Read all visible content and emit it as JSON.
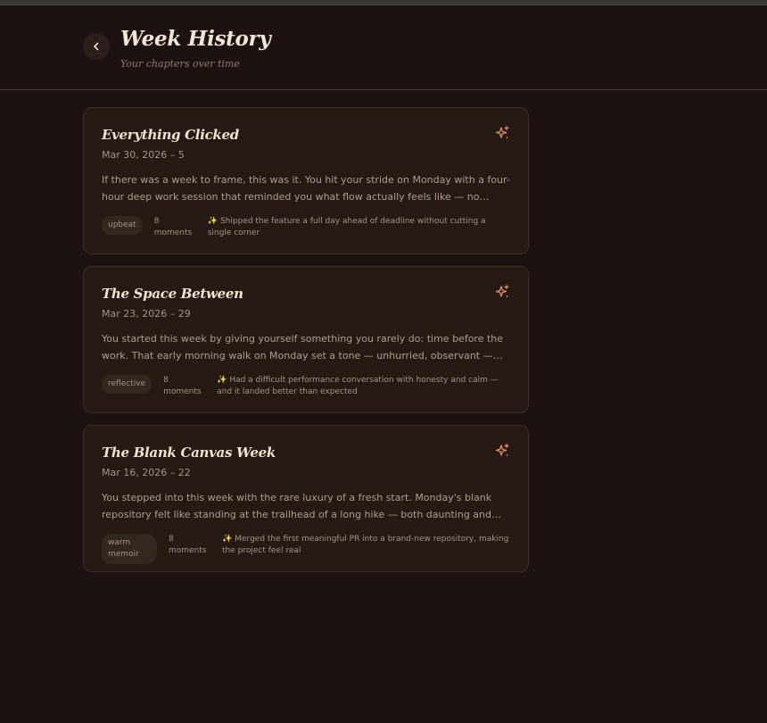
{
  "header": {
    "title": "Week History",
    "subtitle": "Your chapters over time"
  },
  "weeks": [
    {
      "title": "Everything Clicked",
      "date": "Mar 30, 2026 – 5",
      "excerpt": "If there was a week to frame, this was it. You hit your stride on Monday with a four-hour deep work session that reminded you what flow actually feels like — no pings, no…",
      "tag": "upbeat",
      "moments": "8 moments",
      "highlight_icon": "✨",
      "highlight": "Shipped the feature a full day ahead of deadline without cutting a single corner"
    },
    {
      "title": "The Space Between",
      "date": "Mar 23, 2026 – 29",
      "excerpt": "You started this week by giving yourself something you rarely do: time before the work. That early morning walk on Monday set a tone — unhurried, observant — that threaded…",
      "tag": "reflective",
      "moments": "8 moments",
      "highlight_icon": "✨",
      "highlight": "Had a difficult performance conversation with honesty and calm — and it landed better than expected"
    },
    {
      "title": "The Blank Canvas Week",
      "date": "Mar 16, 2026 – 22",
      "excerpt": "You stepped into this week with the rare luxury of a fresh start. Monday's blank repository felt like standing at the trailhead of a long hike — both daunting and…",
      "tag": "warm memoir",
      "moments": "8 moments",
      "highlight_icon": "✨",
      "highlight": "Merged the first meaningful PR into a brand-new repository, making the project feel real"
    }
  ],
  "colors": {
    "background": "#1c1311",
    "card": "#251a14",
    "accent": "#e08a5e",
    "title": "#f3e6d4"
  },
  "icons": {
    "back": "chevron-left-icon",
    "card": "sparkles-icon"
  }
}
